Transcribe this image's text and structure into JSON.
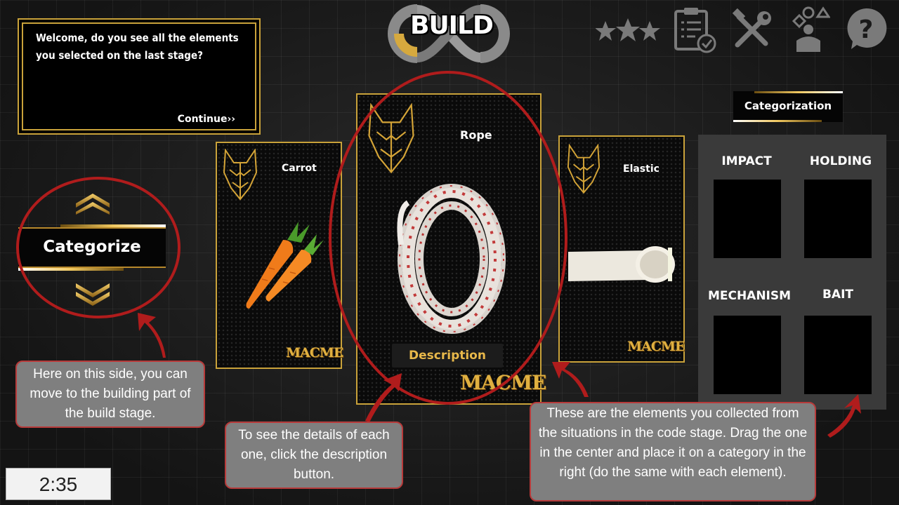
{
  "header": {
    "logo_text": "BUILD"
  },
  "dialog": {
    "text": "Welcome, do you see all the elements you selected on the last stage?",
    "continue_label": "Continue››"
  },
  "toolbar": {
    "icons": [
      "stars-icon",
      "checklist-icon",
      "tools-icon",
      "categories-person-icon",
      "help-icon"
    ]
  },
  "nav": {
    "categorize_label": "Categorize"
  },
  "cards": {
    "left": {
      "title": "Carrot",
      "brand": "MACME"
    },
    "center": {
      "title": "Rope",
      "brand": "MACME",
      "description_label": "Description"
    },
    "right": {
      "title": "Elastic",
      "brand": "MACME"
    }
  },
  "categorization": {
    "header": "Categorization",
    "categories": [
      "IMPACT",
      "HOLDING",
      "MECHANISM",
      "BAIT"
    ]
  },
  "tooltips": {
    "left": "Here on this side, you can move to the building part of the build stage.",
    "center": "To see the details of each one, click the description button.",
    "right": "These are the elements you collected from the situations in the code stage. Drag the one in the center and place it on a category in the right (do the same with each element)."
  },
  "timer": {
    "value": "2:35"
  },
  "colors": {
    "gold": "#c9a23a",
    "annotation_red": "#b01c1c",
    "tooltip_bg": "#7f7f7f"
  }
}
